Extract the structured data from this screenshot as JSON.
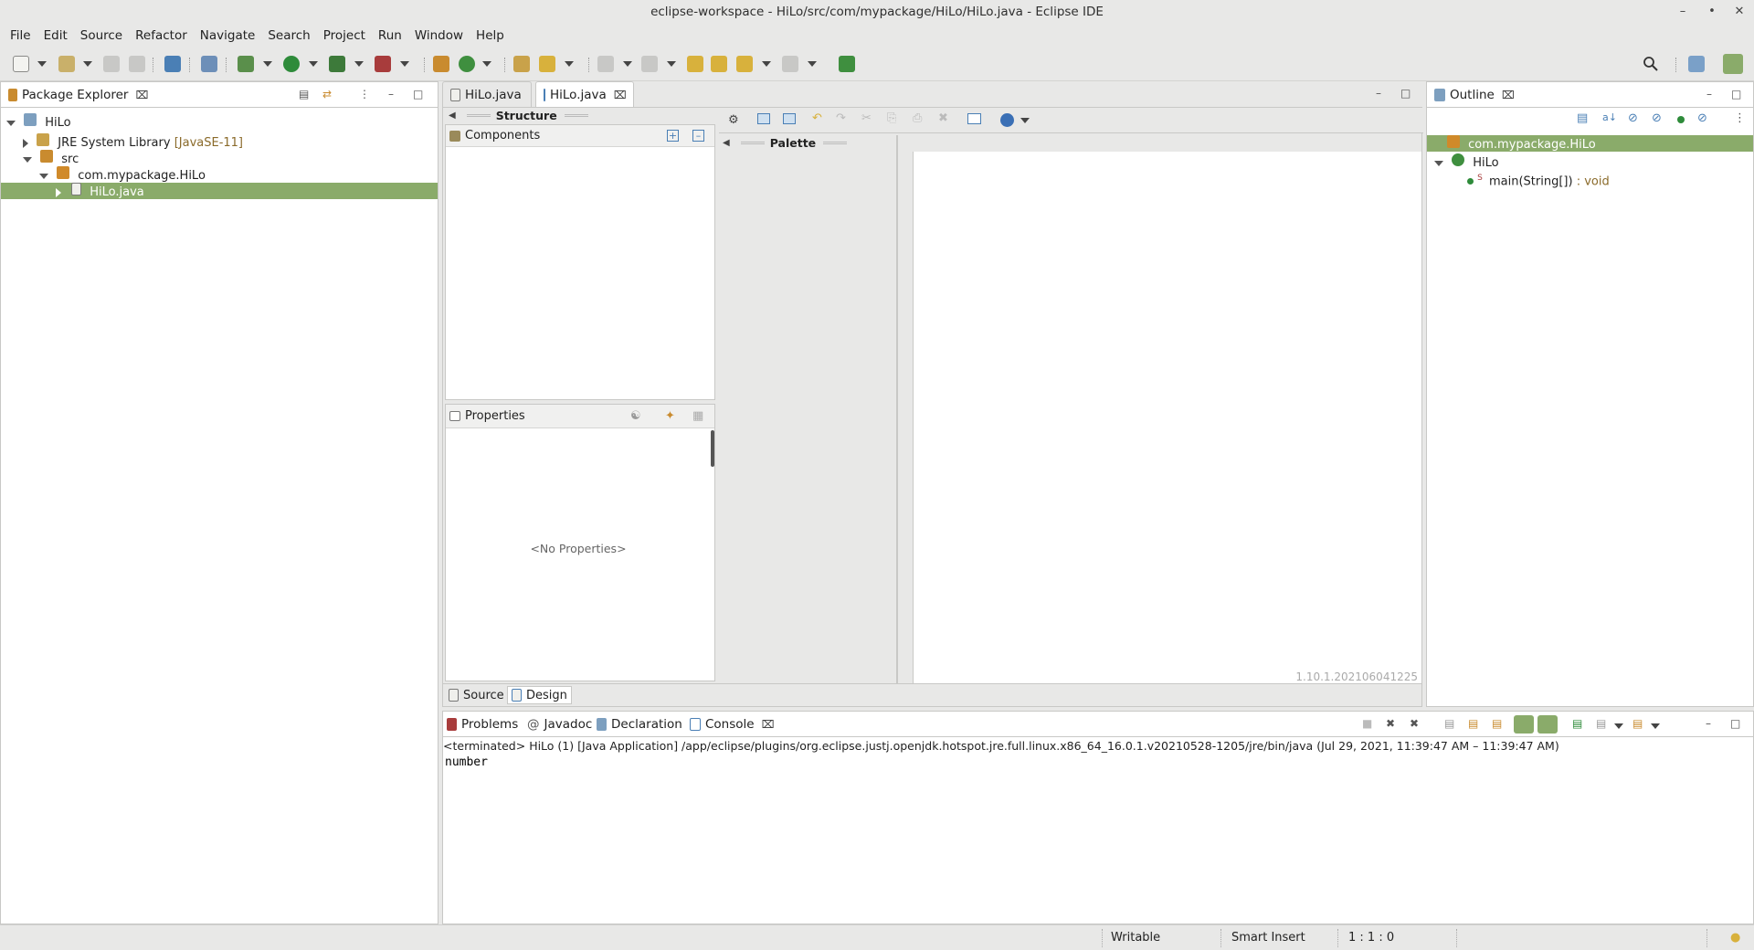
{
  "window": {
    "title": "eclipse-workspace - HiLo/src/com/mypackage/HiLo/HiLo.java - Eclipse IDE"
  },
  "menu": [
    "File",
    "Edit",
    "Source",
    "Refactor",
    "Navigate",
    "Search",
    "Project",
    "Run",
    "Window",
    "Help"
  ],
  "package_explorer": {
    "tab_label": "Package Explorer",
    "tree": [
      {
        "label": "HiLo"
      },
      {
        "label": "JRE System Library",
        "suffix": "[JavaSE-11]"
      },
      {
        "label": "src"
      },
      {
        "label": "com.mypackage.HiLo"
      },
      {
        "label": "HiLo.java"
      }
    ]
  },
  "editor": {
    "tabs": [
      {
        "label": "HiLo.java"
      },
      {
        "label": "HiLo.java"
      }
    ],
    "structure_label": "Structure",
    "components_label": "Components",
    "properties_label": "Properties",
    "no_properties": "<No Properties>",
    "palette_label": "Palette",
    "version": "1.10.1.202106041225",
    "bottom_tabs": [
      {
        "label": "Source"
      },
      {
        "label": "Design"
      }
    ]
  },
  "outline": {
    "tab_label": "Outline",
    "items": [
      {
        "label": "com.mypackage.HiLo"
      },
      {
        "label": "HiLo"
      },
      {
        "label": "main(String[])",
        "suffix": " : void",
        "modifier": "S"
      }
    ]
  },
  "console": {
    "tabs": [
      {
        "label": "Problems"
      },
      {
        "label": "Javadoc"
      },
      {
        "label": "Declaration"
      },
      {
        "label": "Console"
      }
    ],
    "header": "<terminated> HiLo (1) [Java Application] /app/eclipse/plugins/org.eclipse.justj.openjdk.hotspot.jre.full.linux.x86_64_16.0.1.v20210528-1205/jre/bin/java  (Jul 29, 2021, 11:39:47 AM – 11:39:47 AM)",
    "output": "number"
  },
  "status": {
    "writable": "Writable",
    "insert_mode": "Smart Insert",
    "position": "1 : 1 : 0"
  },
  "colors": {
    "selection": "#8aab6a",
    "accent_green": "#2e8b3a",
    "chrome": "#e8e8e7"
  }
}
